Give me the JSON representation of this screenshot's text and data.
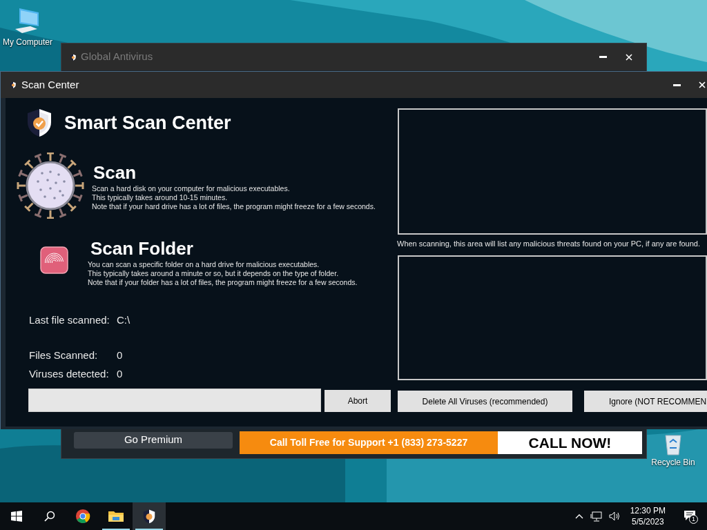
{
  "desktop_icons": [
    {
      "kind": "computer",
      "label": "My Computer"
    },
    {
      "kind": "recycle",
      "label": "Recycle Bin"
    }
  ],
  "back_window": {
    "title": "Global Antivirus",
    "active": false,
    "premium_button": "Go Premium",
    "support_banner": "Call Toll Free for Support +1 (833) 273-5227",
    "call_button": "CALL NOW!"
  },
  "scan_window": {
    "title": "Scan Center",
    "active": true,
    "heading": "Smart Scan Center",
    "options": [
      {
        "kind": "disk",
        "title": "Scan",
        "lines": [
          "Scan a hard disk on your computer for malicious executables.",
          "This typically takes around 10-15 minutes.",
          "Note that if your hard drive has a lot of files, the program might freeze for a few seconds."
        ]
      },
      {
        "kind": "folder",
        "title": "Scan Folder",
        "lines": [
          "You can scan a specific folder on a hard drive for malicious executables.",
          "This typically takes around a minute or so, but it depends on the type of folder.",
          "Note that if your folder has a lot of files, the program might freeze for a few seconds."
        ]
      }
    ],
    "stats": [
      {
        "label": "Last file scanned:",
        "value": "C:\\"
      },
      {
        "label": "Files Scanned:",
        "value": "0"
      },
      {
        "label": "Viruses detected:",
        "value": "0"
      }
    ],
    "progress": {
      "level": 0
    },
    "abort_button": "Abort",
    "threats_note": "When scanning, this area will list any malicious threats found on your PC, if any are found.",
    "action_buttons": [
      "Delete All Viruses (recommended)",
      "Ignore (NOT RECOMMEN"
    ]
  },
  "taskbar": {
    "apps": [
      {
        "kind": "start",
        "running": false,
        "selected": false
      },
      {
        "kind": "search",
        "running": false,
        "selected": false
      },
      {
        "kind": "chrome",
        "running": false,
        "selected": false
      },
      {
        "kind": "explorer",
        "running": true,
        "selected": false
      },
      {
        "kind": "antivirus",
        "running": true,
        "selected": true
      }
    ],
    "time": "12:30 PM",
    "date": "5/5/2023",
    "notification_count": "1"
  }
}
